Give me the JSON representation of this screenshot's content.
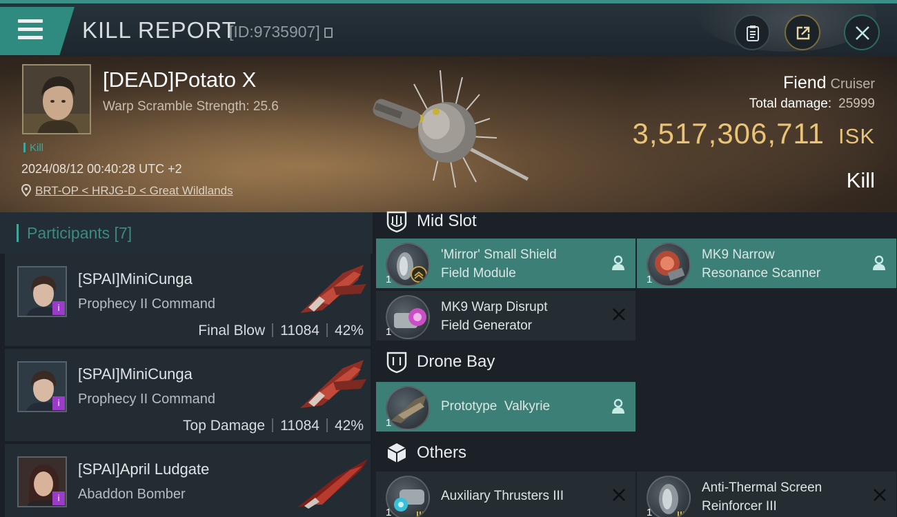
{
  "header": {
    "title": "KILL REPORT",
    "id_label": "[ID:9735907]"
  },
  "victim": {
    "name": "[DEAD]Potato X",
    "warp_scramble": "Warp Scramble Strength: 25.6",
    "tag": "Kill",
    "datetime": "2024/08/12 00:40:28 UTC +2",
    "location": "BRT-OP < HRJG-D < Great Wildlands",
    "ship_name": "Fiend",
    "ship_class": "Cruiser",
    "total_damage_label": "Total damage:",
    "total_damage": "25999",
    "isk_value": "3,517,306,711",
    "isk_unit": "ISK",
    "result": "Kill"
  },
  "participants": {
    "title": "Participants [7]",
    "rows": [
      {
        "name": "[SPAI]MiniCunga",
        "ship": "Prophecy II Command",
        "role": "Final Blow",
        "damage": "11084",
        "percent": "42%",
        "badge": "i"
      },
      {
        "name": "[SPAI]MiniCunga",
        "ship": "Prophecy II Command",
        "role": "Top Damage",
        "damage": "11084",
        "percent": "42%",
        "badge": "i"
      },
      {
        "name": "[SPAI]April Ludgate",
        "ship": "Abaddon Bomber",
        "role": "",
        "damage": "",
        "percent": "",
        "badge": "i"
      }
    ]
  },
  "modules": {
    "mid_slot": {
      "label": "Mid Slot",
      "items": [
        {
          "name": "'Mirror' Small Shield Field Module",
          "line1": "'Mirror' Small Shield",
          "line2": "Field Module",
          "qty": "1",
          "status": "dropped"
        },
        {
          "name": "MK9 Narrow Resonance Scanner",
          "line1": "MK9 Narrow",
          "line2": "Resonance Scanner",
          "qty": "1",
          "status": "dropped"
        },
        {
          "name": "MK9 Warp Disrupt Field Generator",
          "line1": "MK9 Warp Disrupt",
          "line2": "Field Generator",
          "qty": "1",
          "status": "destroyed"
        }
      ]
    },
    "drone_bay": {
      "label": "Drone Bay",
      "items": [
        {
          "name": "Prototype  Valkyrie",
          "qty": "1",
          "status": "dropped"
        }
      ]
    },
    "others": {
      "label": "Others",
      "items": [
        {
          "name": "Auxiliary Thrusters III",
          "qty": "1",
          "status": "destroyed"
        },
        {
          "name": "Anti-Thermal Screen Reinforcer III",
          "line1": "Anti-Thermal Screen",
          "line2": "Reinforcer III",
          "qty": "1",
          "status": "destroyed"
        }
      ]
    }
  },
  "colors": {
    "accent_teal": "#3c7f77",
    "isk_gold": "#e9c376",
    "badge_purple": "#9a3cc8"
  },
  "icons": [
    "menu-icon",
    "clipboard-icon",
    "share-icon",
    "close-icon",
    "location-pin-icon",
    "shield-slot-icon",
    "drone-bay-icon",
    "cube-icon",
    "pilot-icon",
    "x-icon"
  ]
}
